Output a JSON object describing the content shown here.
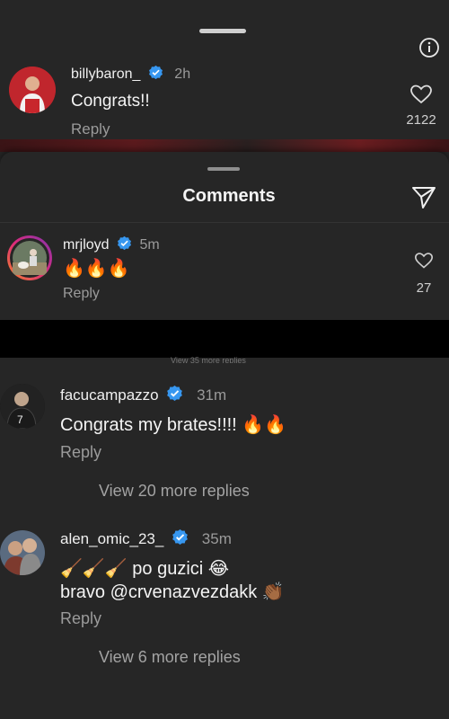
{
  "background_comment": {
    "username": "billybaron_",
    "time": "2h",
    "text": "Congrats!!",
    "reply_label": "Reply",
    "like_count": "2122"
  },
  "sheet": {
    "title": "Comments",
    "comments": [
      {
        "username": "mrjloyd",
        "time": "5m",
        "text": "🔥🔥🔥",
        "reply_label": "Reply",
        "like_count": "27"
      },
      {
        "username": "facucampazzo",
        "time": "31m",
        "text": "Congrats my brates!!!! 🔥🔥",
        "reply_label": "Reply",
        "view_replies": "View 20 more replies"
      },
      {
        "username": "alen_omic_23_",
        "time": "35m",
        "text_line1": "🧹🧹🧹 po guzici 😂",
        "text_line2": "bravo @crvenazvezdakk 👏🏾",
        "reply_label": "Reply",
        "view_replies": "View 6 more replies"
      }
    ],
    "hidden_text": "View 35 more replies"
  },
  "colors": {
    "background": "#262626",
    "sheet": "#262626",
    "verified": "#3797f0",
    "muted": "#9b9b9b"
  }
}
